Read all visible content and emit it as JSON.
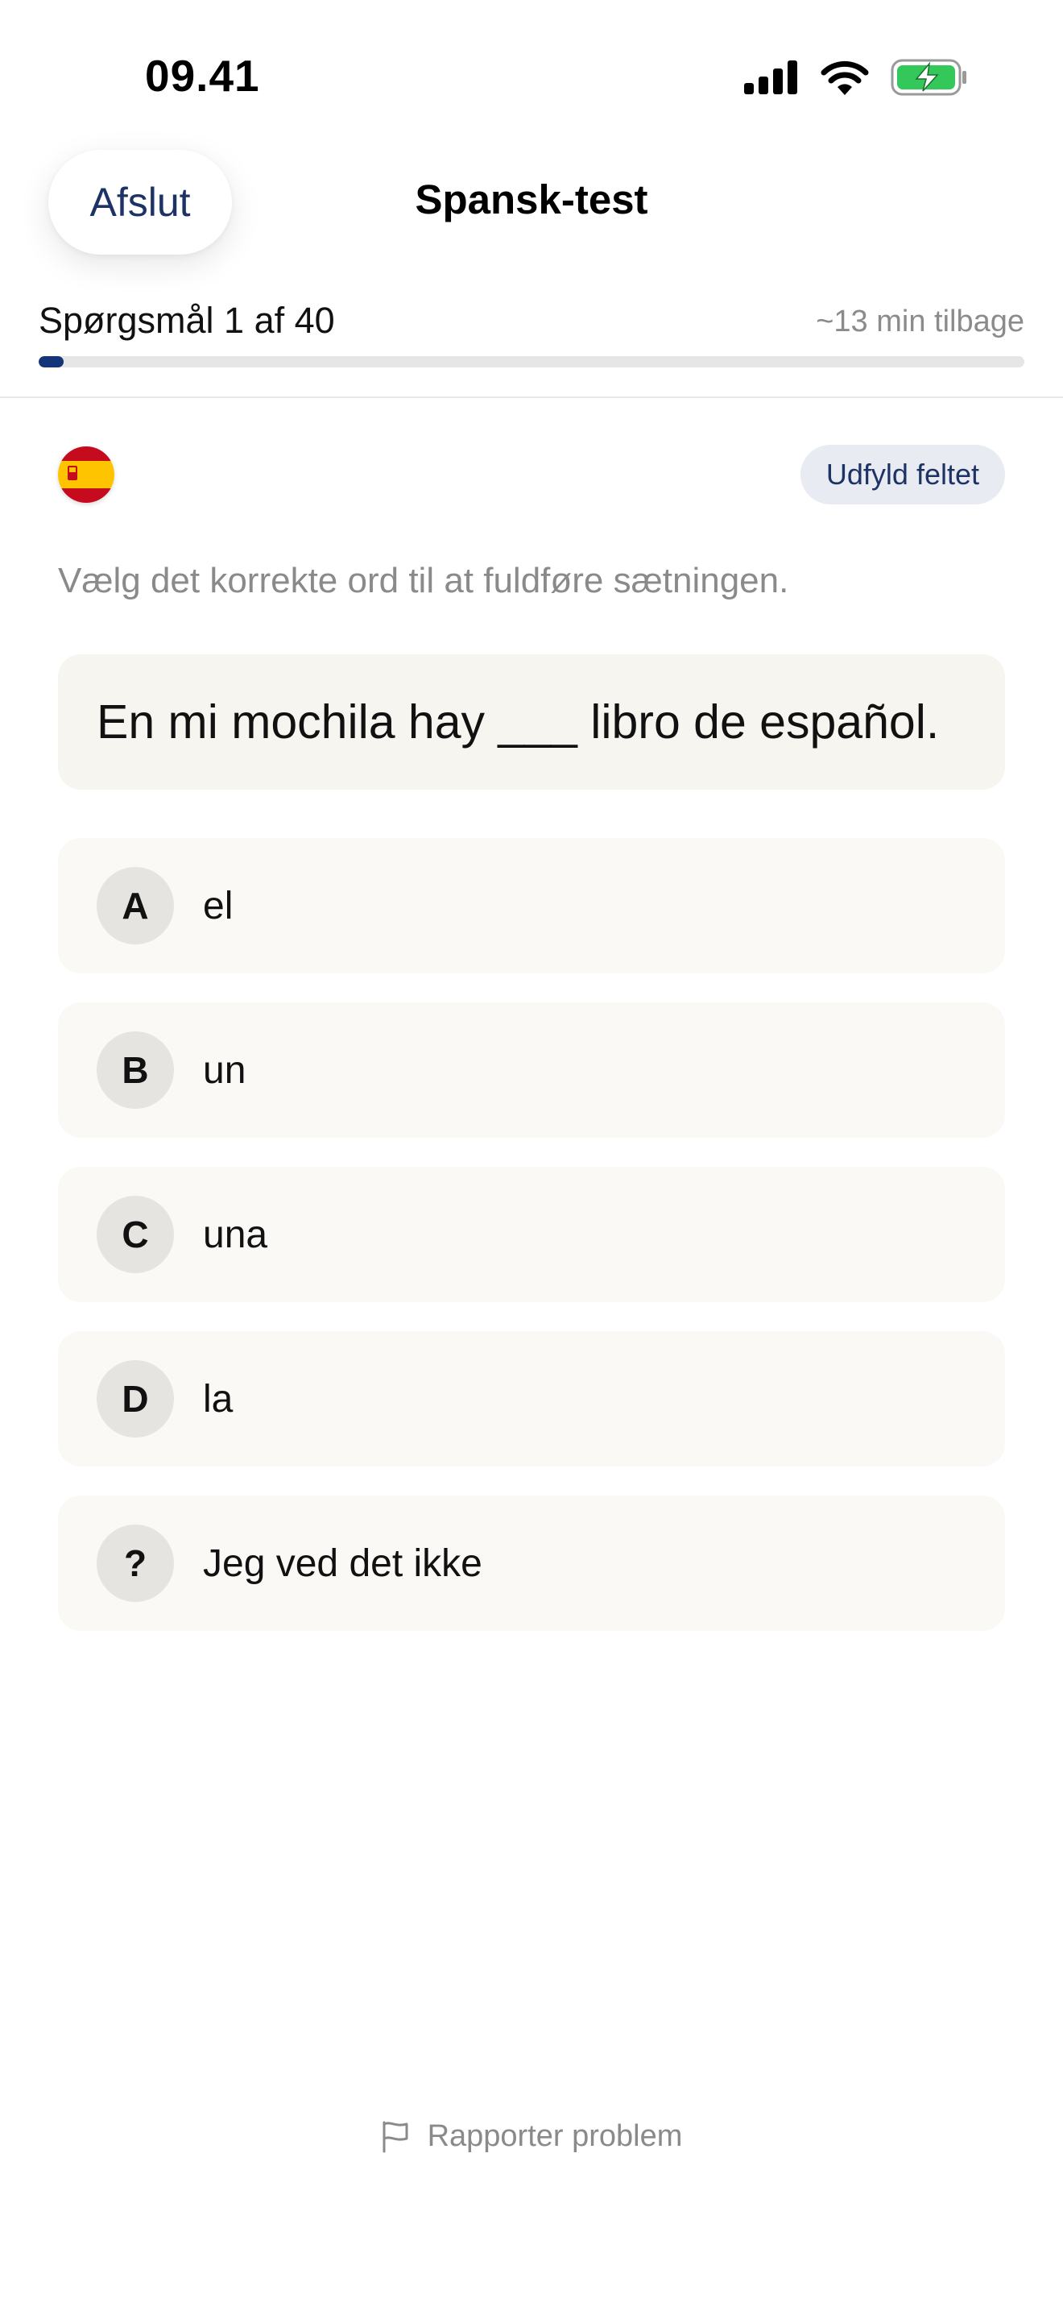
{
  "status_bar": {
    "time": "09.41"
  },
  "header": {
    "close_label": "Afslut",
    "title": "Spansk-test"
  },
  "progress": {
    "label": "Spørgsmål 1 af 40",
    "time_left": "~13 min tilbage",
    "fraction": 0.025
  },
  "question": {
    "flag_icon": "spain-flag-icon",
    "type_badge": "Udfyld feltet",
    "instruction": "Vælg det korrekte ord til at fuldføre sætningen.",
    "sentence_before": "En mi mochila hay ",
    "blank": "___",
    "sentence_after": " libro de español."
  },
  "options": [
    {
      "letter": "A",
      "text": "el"
    },
    {
      "letter": "B",
      "text": "un"
    },
    {
      "letter": "C",
      "text": "una"
    },
    {
      "letter": "D",
      "text": "la"
    },
    {
      "letter": "?",
      "text": "Jeg ved det ikke"
    }
  ],
  "footer": {
    "report_label": "Rapporter problem"
  },
  "colors": {
    "accent": "#15357a",
    "card": "#f7f5ef",
    "option": "#faf9f5",
    "badge": "#e8ebf1"
  }
}
